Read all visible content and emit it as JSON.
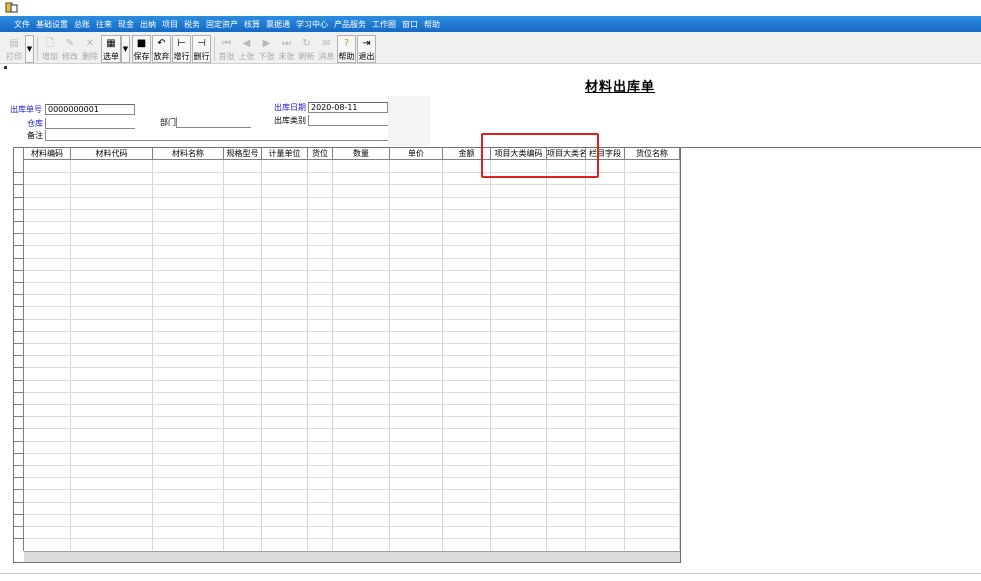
{
  "menu": [
    "文件",
    "基础设置",
    "总账",
    "往来",
    "现金",
    "出纳",
    "项目",
    "税务",
    "固定资产",
    "核算",
    "票据通",
    "学习中心",
    "产品服务",
    "工作圈",
    "窗口",
    "帮助"
  ],
  "toolbar": {
    "print": "打印",
    "add": "增加",
    "modify": "修改",
    "delete": "删除",
    "select_doc": "选单",
    "save": "保存",
    "discard": "放弃",
    "add_row": "增行",
    "delete_row": "删行",
    "first": "首张",
    "prev": "上张",
    "next": "下张",
    "last": "末张",
    "refresh": "刷新",
    "message": "消息",
    "help": "帮助",
    "exit": "退出"
  },
  "form": {
    "title": "材料出库单",
    "doc_no_label": "出库单号",
    "doc_no_value": "0000000001",
    "date_label": "出库日期",
    "date_value": "2020-08-11",
    "warehouse_label": "仓库",
    "warehouse_value": "",
    "dept_label": "部门",
    "dept_value": "",
    "out_type_label": "出库类别",
    "out_type_value": "",
    "remark_label": "备注",
    "remark_value": ""
  },
  "grid": {
    "columns": [
      "材料编码",
      "材料代码",
      "材料名称",
      "规格型号",
      "计量单位",
      "货位",
      "数量",
      "单价",
      "金额",
      "项目大类编码",
      "项目大类名称",
      "栏目字段",
      "货位名称"
    ],
    "rows": 32
  },
  "colors": {
    "menubar": "#1a74d0",
    "highlight": "#e02020",
    "label_blue": "#1a1adc"
  }
}
